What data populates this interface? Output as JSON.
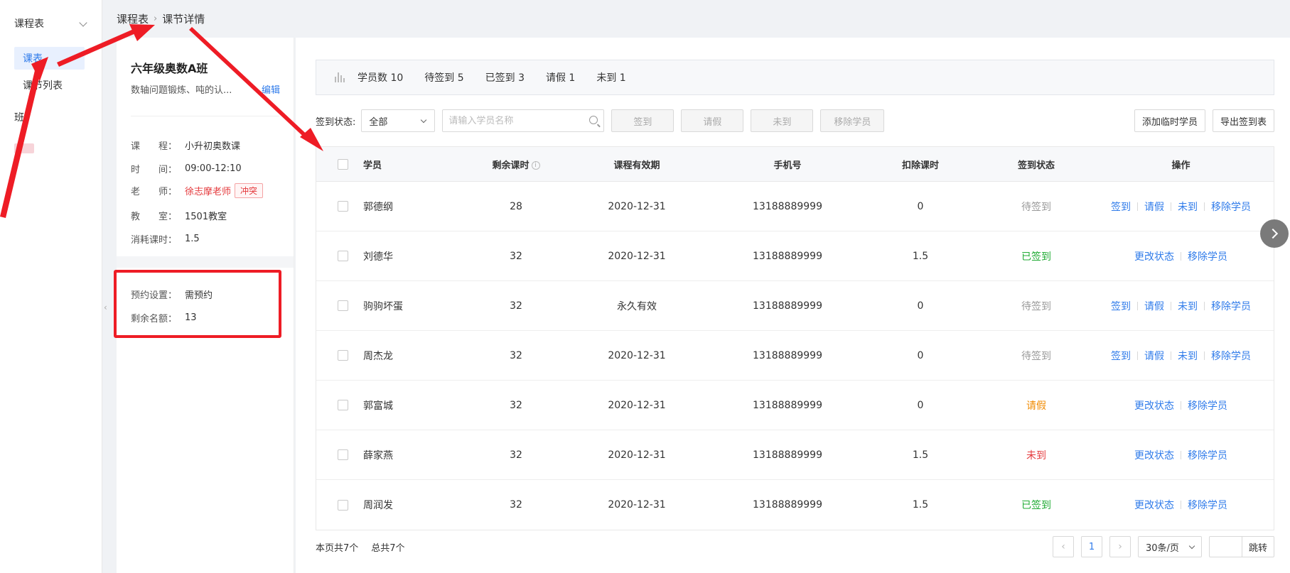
{
  "nav": {
    "group1": "课程表",
    "item_active": "课表",
    "item_list": "课节列表",
    "group2": "班"
  },
  "breadcrumb": {
    "root": "课程表",
    "separator": "›",
    "current": "课节详情"
  },
  "info": {
    "title": "六年级奥数A班",
    "desc": "数轴问题锻炼、吨的认...",
    "edit": "编辑",
    "rows": [
      {
        "k": "课　　程：",
        "v": "小升初奥数课"
      },
      {
        "k": "时　　间：",
        "v": "09:00-12:10"
      },
      {
        "k": "老　　师：",
        "v": "徐志摩老师",
        "tag": "冲突"
      },
      {
        "k": "教　　室：",
        "v": "1501教室"
      },
      {
        "k": "消耗课时：",
        "v": "1.5"
      }
    ],
    "booking": [
      {
        "k": "预约设置：",
        "v": "需预约"
      },
      {
        "k": "剩余名额：",
        "v": "13"
      }
    ]
  },
  "stats": {
    "students": "学员数 10",
    "pending": "待签到 5",
    "signed": "已签到 3",
    "leave": "请假 1",
    "absent": "未到 1"
  },
  "toolbar": {
    "filter_label": "签到状态:",
    "filter_value": "全部",
    "search_placeholder": "请输入学员名称",
    "btn_sign": "签到",
    "btn_leave": "请假",
    "btn_absent": "未到",
    "btn_remove": "移除学员",
    "btn_add_temp": "添加临时学员",
    "btn_export": "导出签到表"
  },
  "table": {
    "headers": [
      "学员",
      "剩余课时",
      "课程有效期",
      "手机号",
      "扣除课时",
      "签到状态",
      "操作"
    ],
    "rows": [
      {
        "name": "郭德纲",
        "remain": "28",
        "valid": "2020-12-31",
        "phone": "13188889999",
        "deduct": "0",
        "status": "待签到"
      },
      {
        "name": "刘德华",
        "remain": "32",
        "valid": "2020-12-31",
        "phone": "13188889999",
        "deduct": "1.5",
        "status": "已签到"
      },
      {
        "name": "驹驹坏蛋",
        "remain": "32",
        "valid": "永久有效",
        "phone": "13188889999",
        "deduct": "0",
        "status": "待签到"
      },
      {
        "name": "周杰龙",
        "remain": "32",
        "valid": "2020-12-31",
        "phone": "13188889999",
        "deduct": "0",
        "status": "待签到"
      },
      {
        "name": "郭富城",
        "remain": "32",
        "valid": "2020-12-31",
        "phone": "13188889999",
        "deduct": "0",
        "status": "请假"
      },
      {
        "name": "薛家燕",
        "remain": "32",
        "valid": "2020-12-31",
        "phone": "13188889999",
        "deduct": "1.5",
        "status": "未到"
      },
      {
        "name": "周润发",
        "remain": "32",
        "valid": "2020-12-31",
        "phone": "13188889999",
        "deduct": "1.5",
        "status": "已签到"
      }
    ],
    "ops": {
      "sign": "签到",
      "leave": "请假",
      "absent": "未到",
      "remove": "移除学员",
      "change": "更改状态"
    }
  },
  "footer": {
    "page_count": "本页共7个",
    "total": "总共7个",
    "current_page": "1",
    "page_size": "30条/页",
    "goto": "跳转"
  },
  "colors": {
    "accent": "#2f7bea",
    "signed": "#1fab33",
    "leave": "#f08a00",
    "absent": "#e4393c",
    "pending": "#999999",
    "annotation": "#ee1c25"
  }
}
